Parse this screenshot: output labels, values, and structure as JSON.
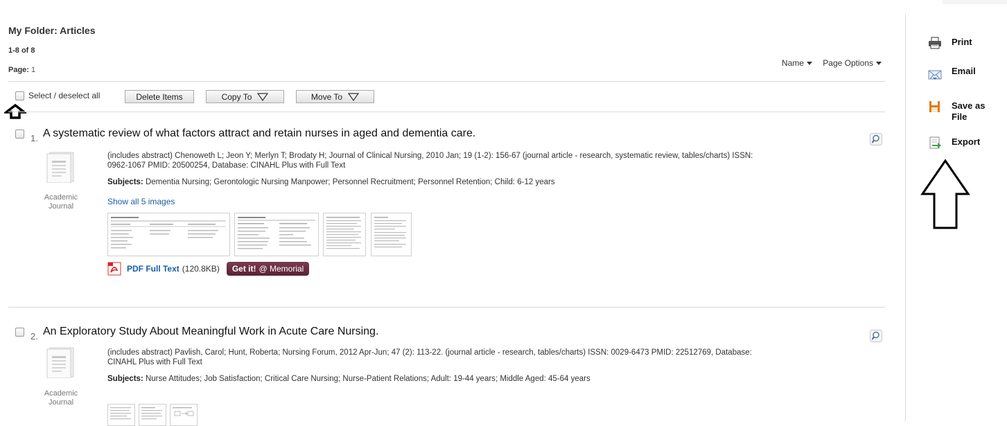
{
  "folder": {
    "title": "My Folder: Articles",
    "count": "1-8 of 8",
    "page_label": "Page:",
    "page_number": "1"
  },
  "sort": {
    "name": "Name",
    "page_options": "Page Options"
  },
  "toolbar": {
    "select_all": "Select / deselect all",
    "delete": "Delete Items",
    "copy_to": "Copy To",
    "move_to": "Move To"
  },
  "results": [
    {
      "number": "1.",
      "title": "A systematic review of what factors attract and retain nurses in aged and dementia care.",
      "pub_type_line1": "Academic",
      "pub_type_line2": "Journal",
      "meta_line1": "(includes abstract) Chenoweth L; Jeon Y; Merlyn T; Brodaty H; Journal of Clinical Nursing, 2010 Jan; 19 (1-2): 156-67 (journal article - research, systematic review, tables/charts) ISSN:",
      "meta_line2": "0962-1067 PMID: 20500254, Database: CINAHL Plus with Full Text",
      "subjects_label": "Subjects:",
      "subjects": "Dementia Nursing; Gerontologic Nursing Manpower; Personnel Recruitment; Personnel Retention; Child: 6-12 years",
      "show_images": "Show all 5 images",
      "pdf_label": "PDF Full Text",
      "pdf_size": "(120.8KB)",
      "getit_a": "Get it!",
      "getit_b": "@ Memorial"
    },
    {
      "number": "2.",
      "title": "An Exploratory Study About Meaningful Work in Acute Care Nursing.",
      "pub_type_line1": "Academic",
      "pub_type_line2": "Journal",
      "meta_line1": "(includes abstract) Pavlish, Carol; Hunt, Roberta; Nursing Forum, 2012 Apr-Jun; 47 (2): 113-22. (journal article - research, tables/charts) ISSN: 0029-6473 PMID: 22512769, Database:",
      "meta_line2": "CINAHL Plus with Full Text",
      "subjects_label": "Subjects:",
      "subjects": "Nurse Attitudes; Job Satisfaction; Critical Care Nursing; Nurse-Patient Relations; Adult: 19-44 years; Middle Aged: 45-64 years"
    }
  ],
  "tools": {
    "print": "Print",
    "email": "Email",
    "save_line1": "Save as",
    "save_line2": "File",
    "export": "Export"
  },
  "colors": {
    "link": "#1a5ea8",
    "getit": "#6b2c42",
    "save_icon": "#e07b17"
  }
}
